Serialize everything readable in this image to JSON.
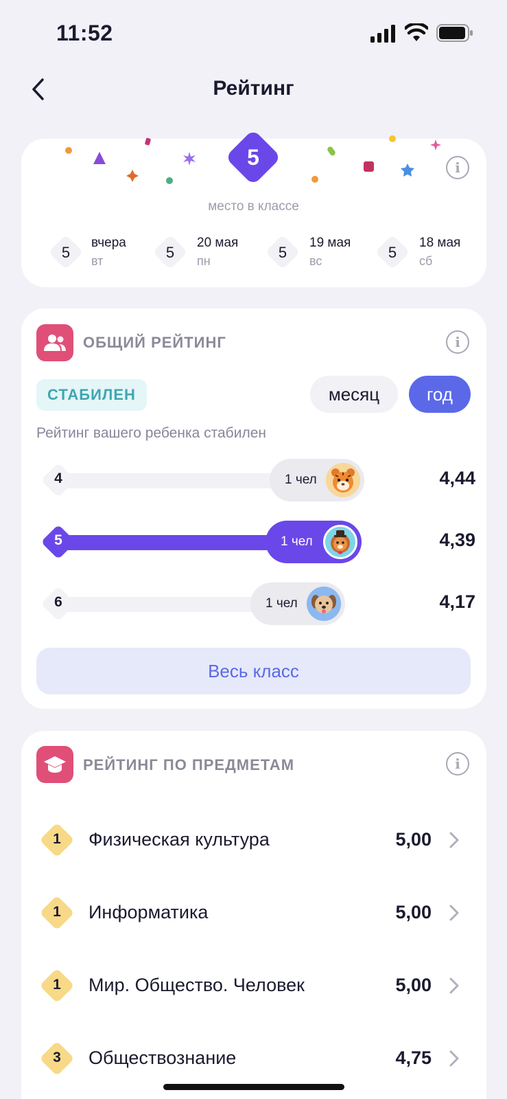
{
  "status_bar": {
    "time": "11:52"
  },
  "header": {
    "title": "Рейтинг"
  },
  "place": {
    "value": "5",
    "label": "место в классе",
    "history": [
      {
        "value": "5",
        "date": "вчера",
        "day": "вт"
      },
      {
        "value": "5",
        "date": "20 мая",
        "day": "пн"
      },
      {
        "value": "5",
        "date": "19 мая",
        "day": "вс"
      },
      {
        "value": "5",
        "date": "18 мая",
        "day": "сб"
      }
    ]
  },
  "overall": {
    "title": "ОБЩИЙ РЕЙТИНГ",
    "status": "СТАБИЛЕН",
    "periods": {
      "month": "месяц",
      "year": "год",
      "selected": "год"
    },
    "description": "Рейтинг вашего ребенка стабилен",
    "ranks": [
      {
        "rank": "4",
        "count": "1 чел",
        "score": "4,44",
        "avatar": "tiger-avatar",
        "bar_fraction": 0.77,
        "self": false
      },
      {
        "rank": "5",
        "count": "1 чел",
        "score": "4,39",
        "avatar": "lion-avatar",
        "bar_fraction": 0.76,
        "self": true
      },
      {
        "rank": "6",
        "count": "1 чел",
        "score": "4,17",
        "avatar": "dog-avatar",
        "bar_fraction": 0.72,
        "self": false
      }
    ],
    "whole_class_label": "Весь класс"
  },
  "subjects": {
    "title": "РЕЙТИНГ ПО ПРЕДМЕТАМ",
    "items": [
      {
        "rank": "1",
        "name": "Физическая культура",
        "score": "5,00"
      },
      {
        "rank": "1",
        "name": "Информатика",
        "score": "5,00"
      },
      {
        "rank": "1",
        "name": "Мир. Общество. Человек",
        "score": "5,00"
      },
      {
        "rank": "3",
        "name": "Обществознание",
        "score": "4,75"
      }
    ]
  },
  "colors": {
    "accent": "#6A47E9",
    "primary_blue": "#5B69E8",
    "section_icon": "#E04F78",
    "stable": "#3FA6B2",
    "gold": "#F7D987"
  }
}
